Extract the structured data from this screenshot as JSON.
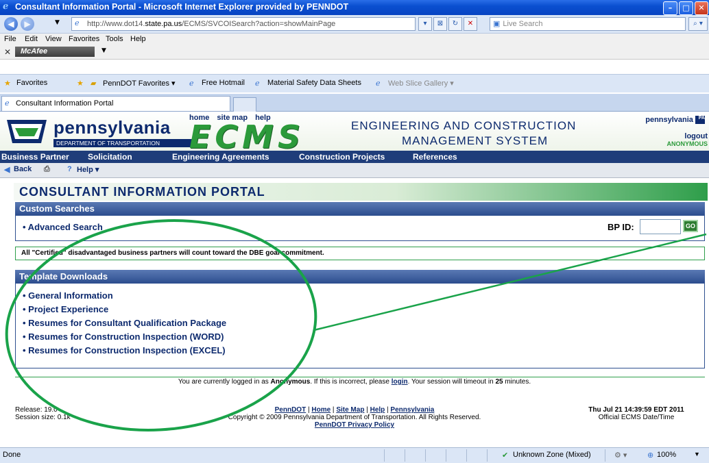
{
  "window": {
    "title": "Consultant Information Portal - Microsoft Internet Explorer provided by PENNDOT"
  },
  "address": {
    "url_prefix": "http://www.dot14.",
    "url_host": "state.pa.us",
    "url_path": "/ECMS/SVCOISearch?action=showMainPage",
    "search_placeholder": "Live Search"
  },
  "menu": {
    "items": [
      "File",
      "Edit",
      "View",
      "Favorites",
      "Tools",
      "Help"
    ]
  },
  "toolbar": {
    "mcafee": "McAfee"
  },
  "favorites": {
    "label": "Favorites",
    "items": [
      "PennDOT Favorites ▾",
      "Free Hotmail",
      "Material Safety Data Sheets",
      "Web Slice Gallery ▾"
    ]
  },
  "tab": {
    "title": "Consultant Information Portal"
  },
  "header": {
    "pa_name": "pennsylvania",
    "pa_dept": "DEPARTMENT OF TRANSPORTATION",
    "links": [
      "home",
      "site map",
      "help"
    ],
    "ecms": "ECMS",
    "line1": "ENGINEERING AND CONSTRUCTION",
    "line2": "MANAGEMENT SYSTEM",
    "right_brand": "pennsylvania",
    "logout": "logout",
    "user": "ANONYMOUS"
  },
  "nav": {
    "items": [
      "Business Partner",
      "Solicitation",
      "Engineering Agreements",
      "Construction Projects",
      "References"
    ]
  },
  "subnav": {
    "back": "Back",
    "help": "Help ▾"
  },
  "page": {
    "title": "CONSULTANT INFORMATION PORTAL",
    "custom_searches": "Custom Searches",
    "advanced_search": "• Advanced Search",
    "bp_id_label": "BP ID:",
    "go": "GO",
    "dbe_note": "All \"Certified\" disadvantaged business partners will count toward the DBE goal commitment.",
    "template_downloads": "Template Downloads",
    "downloads": [
      "• General Information",
      "• Project Experience",
      "• Resumes for Consultant Qualification Package",
      "• Resumes for Construction Inspection (WORD)",
      "• Resumes for Construction Inspection (EXCEL)"
    ]
  },
  "session": {
    "pre": "You are currently logged in as ",
    "user": "Anonymous",
    "mid": ". If this is incorrect, please ",
    "login": "login",
    "post": ". Your session will timeout in ",
    "minutes": "25",
    "end": " minutes."
  },
  "footer": {
    "release": "Release: 19.0",
    "session_size": "Session size: 0.1k",
    "links": [
      "PennDOT",
      "Home",
      "Site Map",
      "Help",
      "Pennsylvania"
    ],
    "copyright": "Copyright © 2009 Pennsylvania Department of Transportation. All Rights Reserved.",
    "privacy": "PennDOT Privacy Policy",
    "datetime": "Thu Jul 21 14:39:59 EDT 2011",
    "datetime_label": "Official ECMS Date/Time"
  },
  "status": {
    "left": "Done",
    "zone": "Unknown Zone (Mixed)",
    "zoom": "100%"
  },
  "colors": {
    "navy": "#0d2a6e",
    "green": "#2b9a3a",
    "annotation": "#1aa34a"
  }
}
